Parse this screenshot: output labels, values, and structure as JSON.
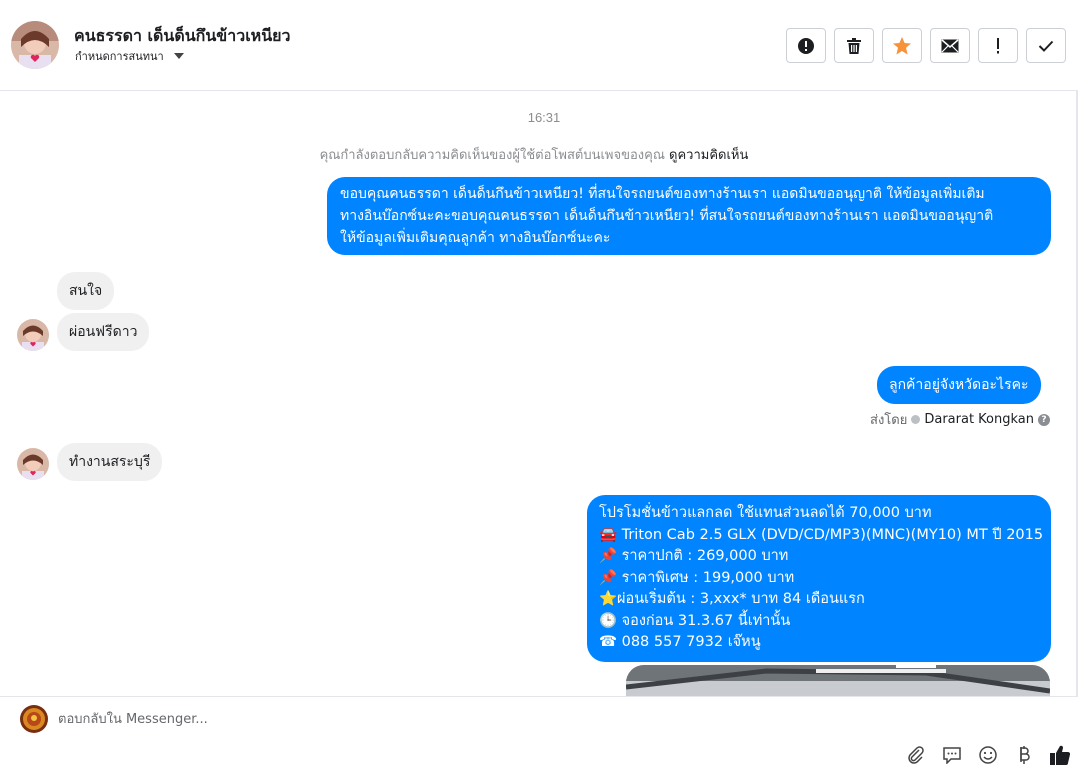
{
  "header": {
    "name": "คนธรรดา เด็นด็นกึนข้าวเหนียว",
    "subtitle": "กำหนดการสนทนา"
  },
  "toolbar": {
    "icons": [
      "report-icon",
      "trash-icon",
      "star-icon",
      "mail-icon",
      "important-icon",
      "check-icon"
    ],
    "star_color": "#f7923b"
  },
  "conversation": {
    "timestamp": "16:31",
    "context_text": "คุณกำลังตอบกลับความคิดเห็นของผู้ใช้ต่อโพสต์บนเพจของคุณ",
    "context_link": "ดูความคิดเห็น",
    "out_message_1": [
      "ขอบคุณคนธรรดา เด็นด็นกึนข้าวเหนียว! ที่สนใจรถยนต์ของทางร้านเรา แอดมินขออนุญาติ ให้ข้อมูลเพิ่มเติม",
      "ทางอินบ๊อกซ์นะคะขอบคุณคนธรรดา เด็นด็นกึนข้าวเหนียว! ที่สนใจรถยนต์ของทางร้านเรา แอดมินขออนุญาติ",
      "ให้ข้อมูลเพิ่มเติมคุณลูกค้า ทางอินบ๊อกซ์นะคะ"
    ],
    "in_message_1": "สนใจ",
    "in_message_2": "ผ่อนฟรีดาว",
    "out_message_2": "ลูกค้าอยู่จังหวัดอะไรคะ",
    "sent_by_label": "ส่งโดย",
    "sent_by_name": "Dararat Kongkan",
    "in_message_3": "ทำงานสระบุรี",
    "promo": {
      "line1": "โปรโมชั่นข้าวแลกลด ใช้แทนส่วนลดได้ 70,000 บาท",
      "line2": "Triton Cab 2.5 GLX (DVD/CD/MP3)(MNC)(MY10) MT ปี 2015",
      "line3": "ราคาปกติ : 269,000 บาท",
      "line4": "ราคาพิเศษ : 199,000 บาท",
      "line5": "ผ่อนเริ่มต้น : 3,xxx* บาท 84 เดือนแรก",
      "line6": "จองก่อน 31.3.67 นี้เท่านั้น",
      "line7": "088 557 7932 เจ๊หนู",
      "emojis": [
        "🚘",
        "📌",
        "📌",
        "⭐",
        "🕒",
        "☎"
      ]
    }
  },
  "composer": {
    "placeholder": "ตอบกลับใน Messenger...",
    "icons": [
      "attachment-icon",
      "saved-replies-icon",
      "emoji-icon",
      "payment-icon",
      "like-icon"
    ]
  },
  "colors": {
    "accent": "#0084ff",
    "incoming_bubble": "#f0f0f0"
  }
}
